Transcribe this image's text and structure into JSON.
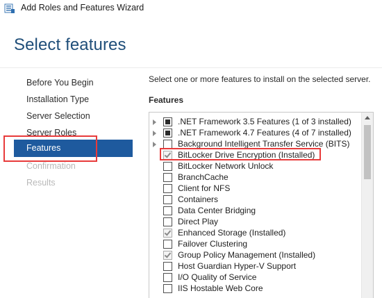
{
  "window": {
    "title": "Add Roles and Features Wizard",
    "icon": "server-manager-icon"
  },
  "page_title": "Select features",
  "nav": {
    "items": [
      {
        "label": "Before You Begin",
        "state": "normal"
      },
      {
        "label": "Installation Type",
        "state": "normal"
      },
      {
        "label": "Server Selection",
        "state": "normal"
      },
      {
        "label": "Server Roles",
        "state": "normal"
      },
      {
        "label": "Features",
        "state": "selected"
      },
      {
        "label": "Confirmation",
        "state": "disabled"
      },
      {
        "label": "Results",
        "state": "disabled"
      }
    ]
  },
  "main": {
    "instruction": "Select one or more features to install on the selected server.",
    "features_heading": "Features",
    "features": [
      {
        "label": ".NET Framework 3.5 Features (1 of 3 installed)",
        "expandable": true,
        "check": "partial"
      },
      {
        "label": ".NET Framework 4.7 Features (4 of 7 installed)",
        "expandable": true,
        "check": "partial"
      },
      {
        "label": "Background Intelligent Transfer Service (BITS)",
        "expandable": true,
        "check": "none"
      },
      {
        "label": "BitLocker Drive Encryption (Installed)",
        "expandable": false,
        "check": "installed"
      },
      {
        "label": "BitLocker Network Unlock",
        "expandable": false,
        "check": "none"
      },
      {
        "label": "BranchCache",
        "expandable": false,
        "check": "none"
      },
      {
        "label": "Client for NFS",
        "expandable": false,
        "check": "none"
      },
      {
        "label": "Containers",
        "expandable": false,
        "check": "none"
      },
      {
        "label": "Data Center Bridging",
        "expandable": false,
        "check": "none"
      },
      {
        "label": "Direct Play",
        "expandable": false,
        "check": "none"
      },
      {
        "label": "Enhanced Storage (Installed)",
        "expandable": false,
        "check": "installed"
      },
      {
        "label": "Failover Clustering",
        "expandable": false,
        "check": "none"
      },
      {
        "label": "Group Policy Management (Installed)",
        "expandable": false,
        "check": "installed"
      },
      {
        "label": "Host Guardian Hyper-V Support",
        "expandable": false,
        "check": "none"
      },
      {
        "label": "I/O Quality of Service",
        "expandable": false,
        "check": "none"
      },
      {
        "label": "IIS Hostable Web Core",
        "expandable": false,
        "check": "none"
      }
    ]
  },
  "colors": {
    "title_blue": "#1f4e79",
    "nav_selected_bg": "#1e5a9e",
    "highlight_red": "#e83a3a"
  }
}
